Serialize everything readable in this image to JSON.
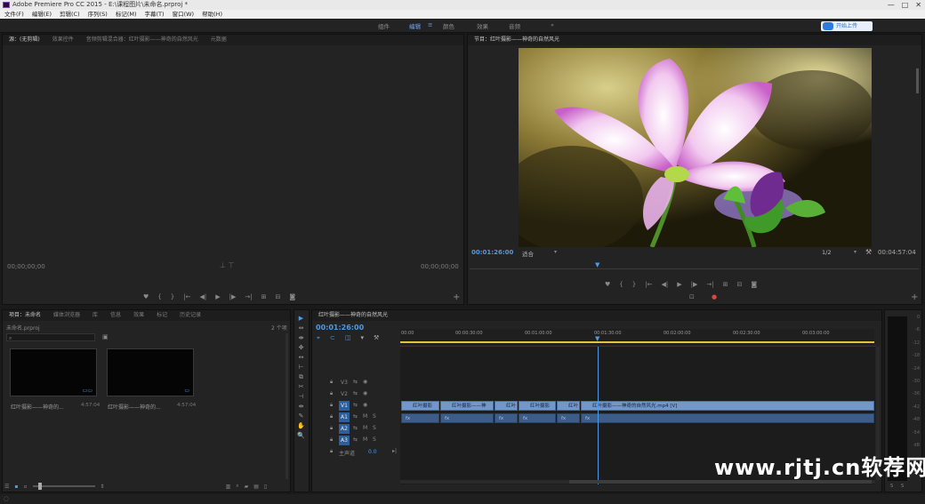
{
  "window": {
    "title": "Adobe Premiere Pro CC 2015 - E:\\课程图片\\未命名.prproj *",
    "controls": [
      "—",
      "□",
      "✕"
    ]
  },
  "menu": [
    "文件(F)",
    "编辑(E)",
    "剪辑(C)",
    "序列(S)",
    "标记(M)",
    "字幕(T)",
    "窗口(W)",
    "帮助(H)"
  ],
  "workspaces": [
    "组件",
    "编辑",
    "颜色",
    "效果",
    "音频",
    "»"
  ],
  "sync_button": "开始上传",
  "source_panel": {
    "tabs": [
      "源：(无剪辑)",
      "效果控件",
      "音频剪辑混合器：红叶摄影——神奇的自然风光",
      "元数据"
    ],
    "timecode_left": "00;00;00;00",
    "timecode_right": "00;00;00;00",
    "controls": [
      "♥",
      "{",
      "}",
      "|←",
      "◀|",
      "▶",
      "|▶",
      "→|",
      "⊞",
      "⊟",
      "◙"
    ]
  },
  "program_panel": {
    "tab": "节目：红叶摄影——神奇的自然风光",
    "timecode": "00:01:26:00",
    "fit": "适合",
    "quality": "1/2",
    "duration": "00:04:57:04",
    "controls": [
      "♥",
      "{",
      "}",
      "|←",
      "◀|",
      "▶",
      "|▶",
      "→|",
      "⊞",
      "⊟",
      "◙"
    ]
  },
  "project_panel": {
    "tabs": [
      "项目：未命名",
      "媒体浏览器",
      "库",
      "信息",
      "效果",
      "标记",
      "历史记录"
    ],
    "file": "未命名.prproj",
    "item_count": "2 个项",
    "items": [
      {
        "name": "红叶摄影——神奇的...",
        "duration": "4:57:04"
      },
      {
        "name": "红叶摄影——神奇的...",
        "duration": "4:57:04"
      }
    ]
  },
  "tools": [
    "▶",
    "⇔",
    "⇼",
    "✥",
    "↔",
    "⊢",
    "⧉",
    "✂",
    "⊣",
    "⇹",
    "✎",
    "✋",
    "🔍"
  ],
  "timeline": {
    "tab": "红叶摄影——神奇的自然风光",
    "timecode": "00:01:26:00",
    "ruler": [
      "00:00",
      "00:00:30:00",
      "00:01:00:00",
      "00:01:30:00",
      "00:02:00:00",
      "00:02:30:00",
      "00:03:00:00"
    ],
    "tracks": [
      {
        "id": "V3",
        "active": false
      },
      {
        "id": "V2",
        "active": false
      },
      {
        "id": "V1",
        "active": true
      },
      {
        "id": "A1",
        "active": true
      },
      {
        "id": "A2",
        "active": true
      },
      {
        "id": "A3",
        "active": true
      }
    ],
    "master": {
      "label": "主声道",
      "value": "0.0"
    },
    "video_clips": [
      "红叶摄影",
      "红叶摄影——神",
      "红叶",
      "红叶摄影",
      "红叶",
      "红叶摄影——神奇的自然风光.mp4 [V]"
    ],
    "audio_clip_marker": "fx"
  },
  "meter_labels": [
    "0",
    "-6",
    "-12",
    "-18",
    "-24",
    "-30",
    "-36",
    "-42",
    "-48",
    "-54",
    "dB"
  ],
  "meter_solo": [
    "S",
    "S"
  ],
  "watermark": "www.rjtj.cn软荐网",
  "colors": {
    "accent_blue": "#4d9be6",
    "ruler_yellow": "#e0c43a",
    "clip_video": "#7597c7",
    "clip_audio": "#3d5c88"
  }
}
